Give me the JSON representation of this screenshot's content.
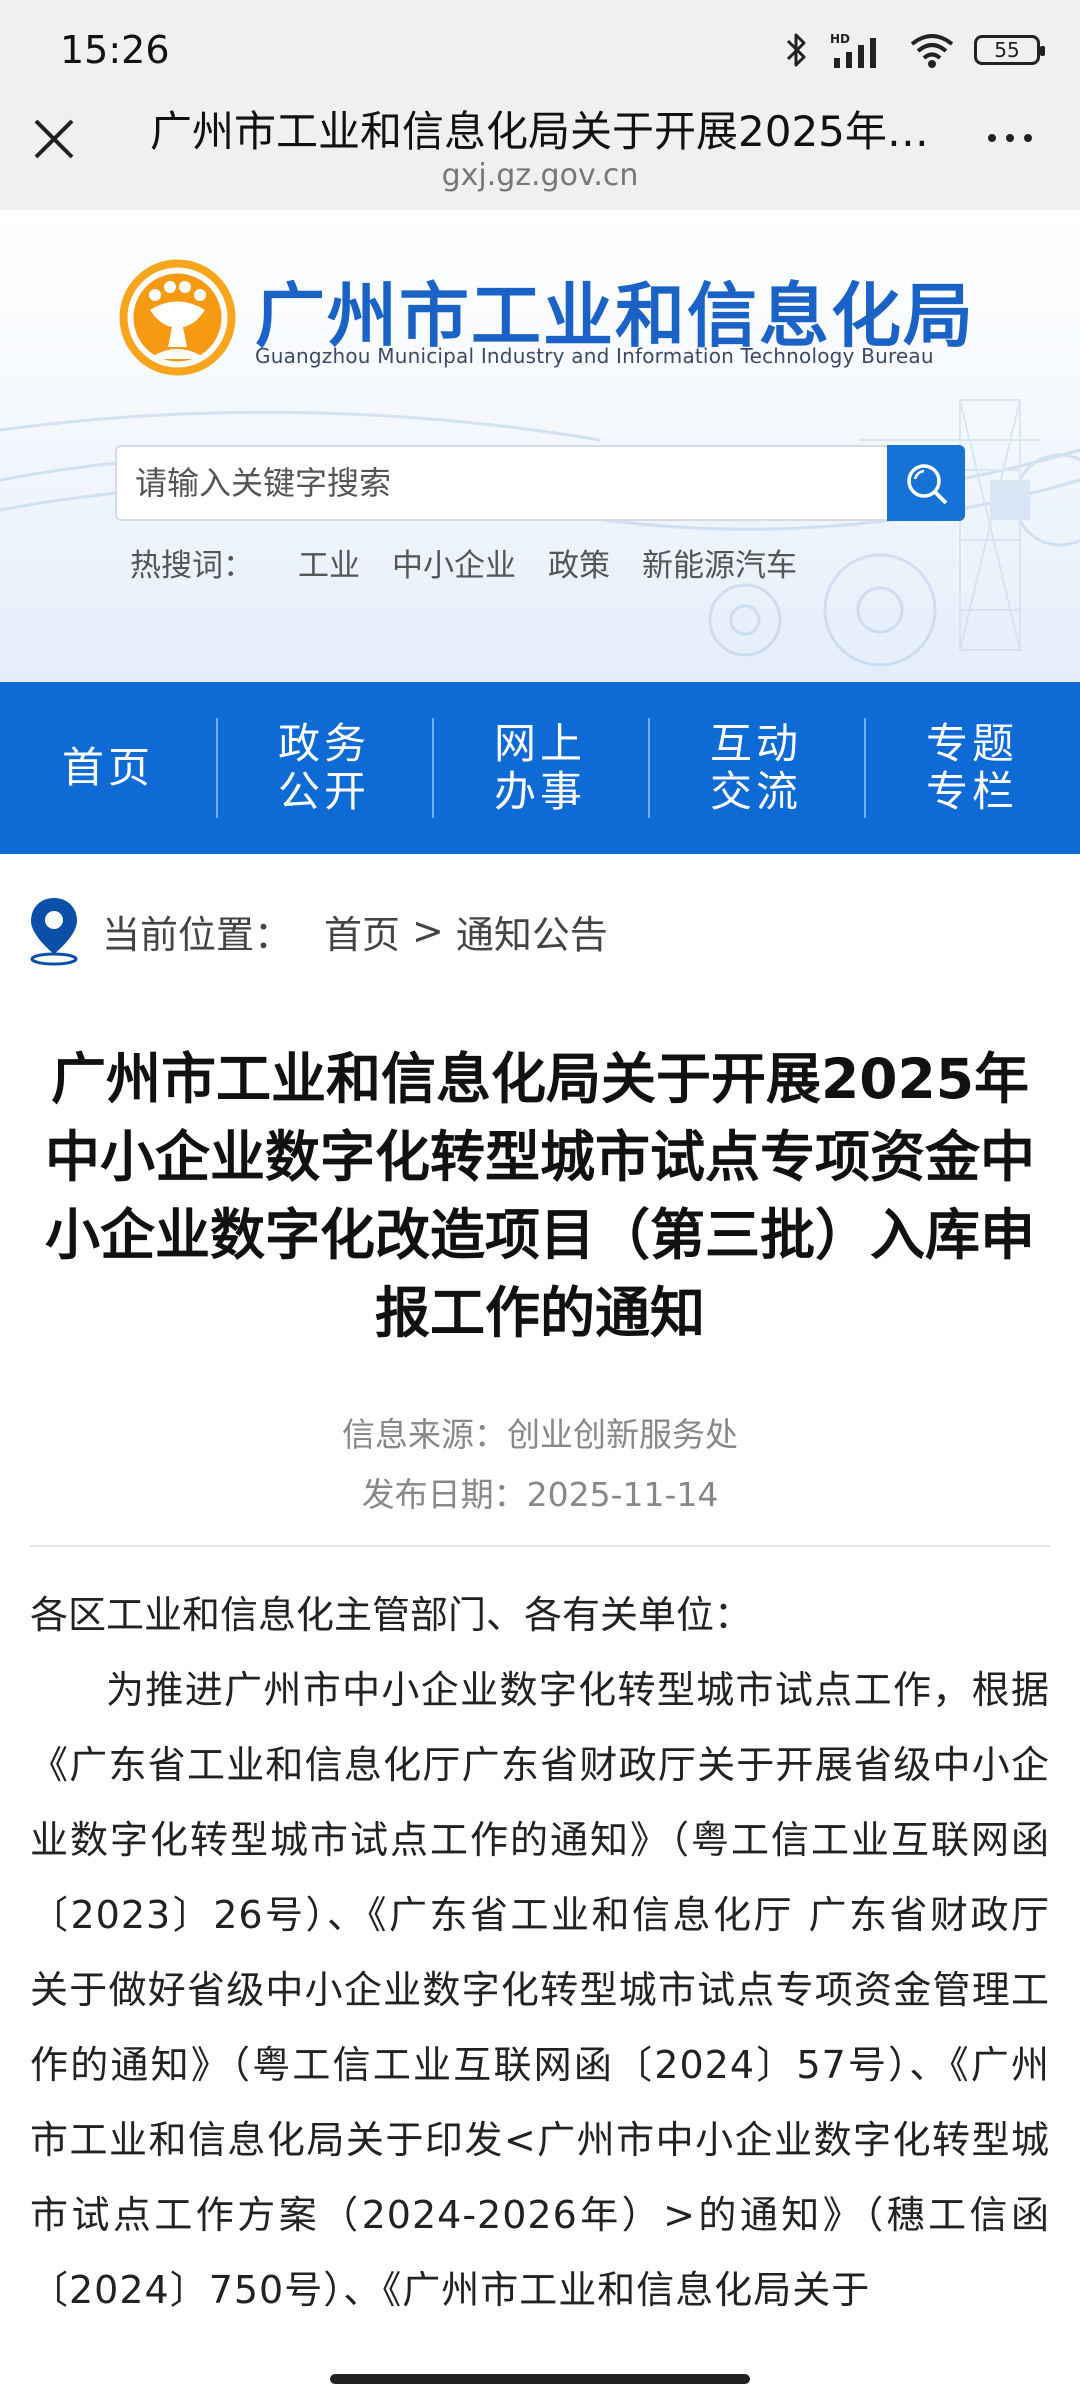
{
  "status_bar": {
    "time": "15:26",
    "battery": "55",
    "network": "HD"
  },
  "browser": {
    "title": "广州市工业和信息化局关于开展2025年中小企业数字化转型城市试点专项资金中小企业数字化改造项目（第三批）入库申报工作的通知",
    "url": "gxj.gz.gov.cn",
    "icons": [
      "close-icon",
      "more-icon"
    ]
  },
  "header": {
    "site_name": "广州市工业和信息化局",
    "site_name_en": "Guangzhou Municipal Industry and Information Technology Bureau",
    "search_placeholder": "请输入关键字搜索",
    "hot_label": "热搜词：",
    "hot_words": [
      "工业",
      "中小企业",
      "政策",
      "新能源汽车"
    ],
    "brand_color": "#1b62c7"
  },
  "nav": {
    "items": [
      "首页",
      "政务公开",
      "网上办事",
      "互动交流",
      "专题专栏"
    ],
    "bg_color": "#0e6ad4"
  },
  "breadcrumb": {
    "label": "当前位置：",
    "home": "首页",
    "separator": ">",
    "current": "通知公告"
  },
  "article": {
    "title": "广州市工业和信息化局关于开展2025年中小企业数字化转型城市试点专项资金中小企业数字化改造项目（第三批）入库申报工作的通知",
    "source": "信息来源：创业创新服务处",
    "date": "发布日期：2025-11-14",
    "salutation": "各区工业和信息化主管部门、各有关单位：",
    "paragraph": "为推进广州市中小企业数字化转型城市试点工作，根据《广东省工业和信息化厅广东省财政厅关于开展省级中小企业数字化转型城市试点工作的通知》（粤工信工业互联网函〔2023〕26号）、《广东省工业和信息化厅 广东省财政厅关于做好省级中小企业数字化转型城市试点专项资金管理工作的通知》（粤工信工业互联网函〔2024〕57号）、《广州市工业和信息化局关于印发<广州市中小企业数字化转型城市试点工作方案（2024-2026年）>的通知》（穗工信函〔2024〕750号）、《广州市工业和信息化局关于"
  }
}
